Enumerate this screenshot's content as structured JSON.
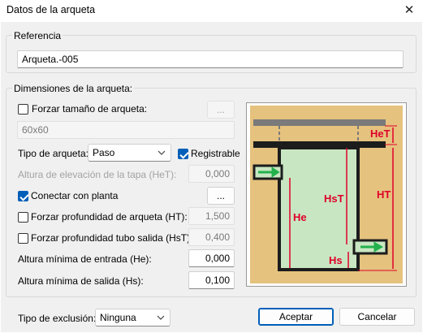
{
  "window": {
    "title": "Datos de la arqueta",
    "close_glyph": "✕"
  },
  "referencia": {
    "legend": "Referencia",
    "value": "Arqueta.-005"
  },
  "dimensiones": {
    "legend": "Dimensiones de la arqueta:",
    "forzar_tamano": {
      "label": "Forzar tamaño de arqueta:",
      "checked": false,
      "button": "...",
      "size_value": "60x60"
    },
    "tipo": {
      "label": "Tipo de arqueta:",
      "selected": "Paso"
    },
    "registrable": {
      "label": "Registrable",
      "checked": true
    },
    "altura_tapa": {
      "label": "Altura de elevación de la tapa (HeT):",
      "value": "0,000"
    },
    "conectar": {
      "label": "Conectar con planta",
      "checked": true,
      "button": "..."
    },
    "forzar_prof_arqueta": {
      "label": "Forzar profundidad de arqueta (HT):",
      "checked": false,
      "value": "1,500"
    },
    "forzar_prof_tubo": {
      "label": "Forzar profundidad tubo salida (HsT):",
      "checked": false,
      "value": "0,400"
    },
    "altura_entrada": {
      "label": "Altura mínima de entrada (He):",
      "value": "0,000"
    },
    "altura_salida": {
      "label": "Altura mínima de salida (Hs):",
      "value": "0,100"
    }
  },
  "diagram": {
    "labels": {
      "het": "HeT",
      "hst": "HsT",
      "ht": "HT",
      "he": "He",
      "hs": "Hs"
    },
    "colors": {
      "soil": "#e5c27e",
      "water": "#c8e6c2",
      "dim": "#e0002a",
      "arrow": "#22b14c",
      "wall": "#1c1c1c",
      "lid": "#7a7a7a"
    }
  },
  "footer": {
    "exclusion_label": "Tipo de exclusión:",
    "exclusion_selected": "Ninguna",
    "accept": "Aceptar",
    "cancel": "Cancelar"
  },
  "icons": {
    "dropdown": "chevron-down-icon",
    "close": "close-icon",
    "checkmark": "checkmark-icon"
  }
}
